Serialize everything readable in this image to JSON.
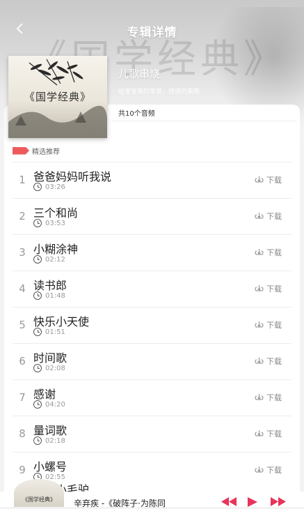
{
  "header": {
    "title": "专辑详情",
    "back_icon": "chevron-left-icon"
  },
  "album": {
    "cover_title": "《国学经典》",
    "name": "儿歌串烧",
    "description": "给宝宝美的享受，情感的熏陶",
    "track_count": "共10个音频"
  },
  "section": {
    "label": "精选推荐",
    "flag_color": "#ee5a5a"
  },
  "download_label": "下载",
  "tracks": [
    {
      "num": "1",
      "title": "爸爸妈妈听我说",
      "duration": "03:26"
    },
    {
      "num": "2",
      "title": "三个和尚",
      "duration": "03:53"
    },
    {
      "num": "3",
      "title": "小糊涂神",
      "duration": "02:12"
    },
    {
      "num": "4",
      "title": "读书郎",
      "duration": "01:48"
    },
    {
      "num": "5",
      "title": "快乐小天使",
      "duration": "01:51"
    },
    {
      "num": "6",
      "title": "时间歌",
      "duration": "02:08"
    },
    {
      "num": "7",
      "title": "感谢",
      "duration": "04:20"
    },
    {
      "num": "8",
      "title": "量词歌",
      "duration": "02:18"
    },
    {
      "num": "9",
      "title": "小螺号",
      "duration": "02:55"
    }
  ],
  "partial_row": {
    "title": "三只小毛驴"
  },
  "player": {
    "thumb_title": "《国学经典》",
    "now_playing": "辛弃疾 -《破阵子·为陈同",
    "accent": "#e8335a"
  }
}
